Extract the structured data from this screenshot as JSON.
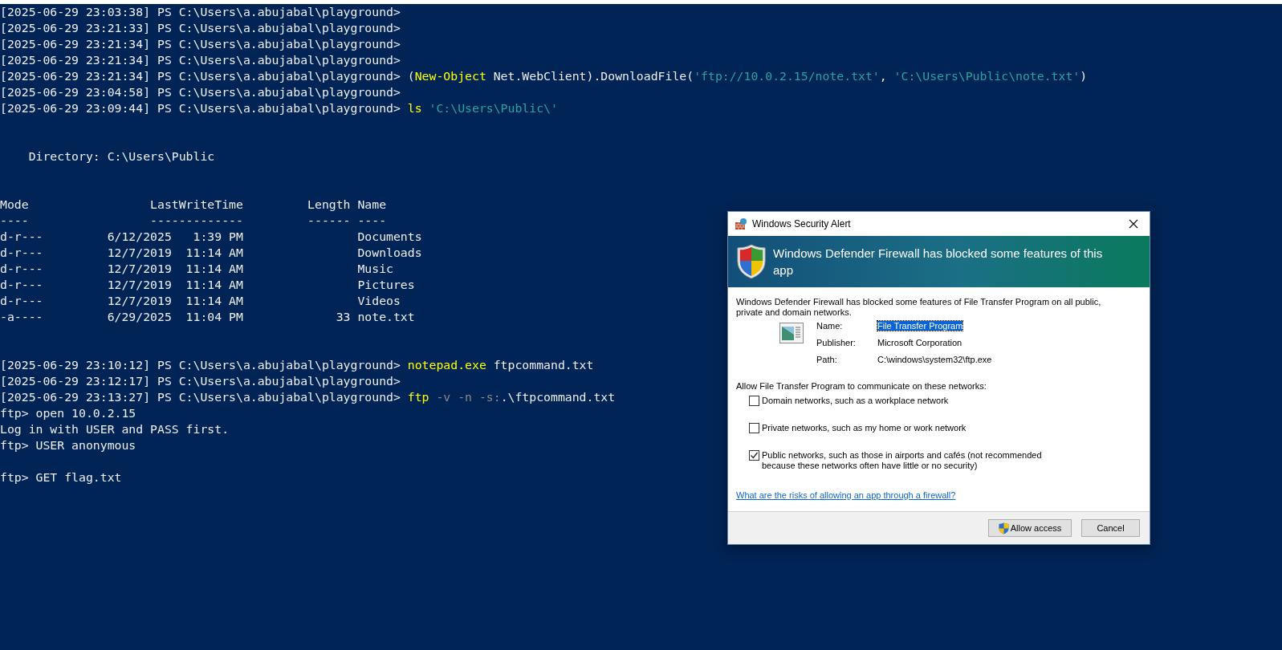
{
  "terminal": {
    "lines": [
      {
        "kind": "text",
        "segments": [
          {
            "kind": "plain",
            "text": "[2025-06-29 23:03:38] PS C:\\Users\\a.abujabal\\playground>"
          }
        ]
      },
      {
        "kind": "text",
        "segments": [
          {
            "kind": "plain",
            "text": "[2025-06-29 23:21:33] PS C:\\Users\\a.abujabal\\playground>"
          }
        ]
      },
      {
        "kind": "text",
        "segments": [
          {
            "kind": "plain",
            "text": "[2025-06-29 23:21:34] PS C:\\Users\\a.abujabal\\playground>"
          }
        ]
      },
      {
        "kind": "text",
        "segments": [
          {
            "kind": "plain",
            "text": "[2025-06-29 23:21:34] PS C:\\Users\\a.abujabal\\playground>"
          }
        ]
      },
      {
        "kind": "text",
        "segments": [
          {
            "kind": "plain",
            "text": "[2025-06-29 23:21:34] PS C:\\Users\\a.abujabal\\playground> ("
          },
          {
            "kind": "command",
            "text": "New-Object"
          },
          {
            "kind": "plain",
            "text": " Net.WebClient).DownloadFile("
          },
          {
            "kind": "string",
            "text": "'ftp://10.0.2.15/note.txt'"
          },
          {
            "kind": "plain",
            "text": ", "
          },
          {
            "kind": "string",
            "text": "'C:\\Users\\Public\\note.txt'"
          },
          {
            "kind": "plain",
            "text": ")"
          }
        ]
      },
      {
        "kind": "text",
        "segments": [
          {
            "kind": "plain",
            "text": "[2025-06-29 23:04:58] PS C:\\Users\\a.abujabal\\playground>"
          }
        ]
      },
      {
        "kind": "text",
        "segments": [
          {
            "kind": "plain",
            "text": "[2025-06-29 23:09:44] PS C:\\Users\\a.abujabal\\playground> "
          },
          {
            "kind": "command",
            "text": "ls"
          },
          {
            "kind": "string",
            "text": " 'C:\\Users\\Public\\'"
          }
        ]
      },
      {
        "kind": "blank"
      },
      {
        "kind": "blank"
      },
      {
        "kind": "text",
        "segments": [
          {
            "kind": "plain",
            "text": "    Directory: C:\\Users\\Public"
          }
        ]
      },
      {
        "kind": "blank"
      },
      {
        "kind": "blank"
      },
      {
        "kind": "text",
        "segments": [
          {
            "kind": "plain",
            "text": "Mode                 LastWriteTime         Length Name"
          }
        ]
      },
      {
        "kind": "text",
        "segments": [
          {
            "kind": "plain",
            "text": "----                 -------------         ------ ----"
          }
        ]
      },
      {
        "kind": "text",
        "segments": [
          {
            "kind": "plain",
            "text": "d-r---         6/12/2025   1:39 PM                Documents"
          }
        ]
      },
      {
        "kind": "text",
        "segments": [
          {
            "kind": "plain",
            "text": "d-r---         12/7/2019  11:14 AM                Downloads"
          }
        ]
      },
      {
        "kind": "text",
        "segments": [
          {
            "kind": "plain",
            "text": "d-r---         12/7/2019  11:14 AM                Music"
          }
        ]
      },
      {
        "kind": "text",
        "segments": [
          {
            "kind": "plain",
            "text": "d-r---         12/7/2019  11:14 AM                Pictures"
          }
        ]
      },
      {
        "kind": "text",
        "segments": [
          {
            "kind": "plain",
            "text": "d-r---         12/7/2019  11:14 AM                Videos"
          }
        ]
      },
      {
        "kind": "text",
        "segments": [
          {
            "kind": "plain",
            "text": "-a----         6/29/2025  11:04 PM             33 note.txt"
          }
        ]
      },
      {
        "kind": "blank"
      },
      {
        "kind": "blank"
      },
      {
        "kind": "text",
        "segments": [
          {
            "kind": "plain",
            "text": "[2025-06-29 23:10:12] PS C:\\Users\\a.abujabal\\playground> "
          },
          {
            "kind": "command",
            "text": "notepad.exe"
          },
          {
            "kind": "plain",
            "text": " ftpcommand.txt"
          }
        ]
      },
      {
        "kind": "text",
        "segments": [
          {
            "kind": "plain",
            "text": "[2025-06-29 23:12:17] PS C:\\Users\\a.abujabal\\playground>"
          }
        ]
      },
      {
        "kind": "text",
        "segments": [
          {
            "kind": "plain",
            "text": "[2025-06-29 23:13:27] PS C:\\Users\\a.abujabal\\playground> "
          },
          {
            "kind": "command",
            "text": "ftp"
          },
          {
            "kind": "param",
            "text": " -v -n -s:"
          },
          {
            "kind": "plain",
            "text": ".\\ftpcommand.txt"
          }
        ]
      },
      {
        "kind": "text",
        "segments": [
          {
            "kind": "plain",
            "text": "ftp> open 10.0.2.15"
          }
        ]
      },
      {
        "kind": "text",
        "segments": [
          {
            "kind": "plain",
            "text": "Log in with USER and PASS first."
          }
        ]
      },
      {
        "kind": "text",
        "segments": [
          {
            "kind": "plain",
            "text": "ftp> USER anonymous"
          }
        ]
      },
      {
        "kind": "blank"
      },
      {
        "kind": "text",
        "segments": [
          {
            "kind": "plain",
            "text": "ftp> GET flag.txt"
          }
        ]
      }
    ]
  },
  "alert": {
    "title": "Windows Security Alert",
    "heading": "Windows Defender Firewall has blocked some features of this app",
    "message": "Windows Defender Firewall has blocked some features of File Transfer Program on all public, private and domain networks.",
    "app_fields": [
      {
        "label": "Name:",
        "value": "File Transfer Program",
        "selected": true
      },
      {
        "label": "Publisher:",
        "value": "Microsoft Corporation",
        "selected": false
      },
      {
        "label": "Path:",
        "value": "C:\\windows\\system32\\ftp.exe",
        "selected": false
      }
    ],
    "networks_prompt": "Allow File Transfer Program to communicate on these networks:",
    "networks": [
      {
        "label": "Domain networks, such as a workplace network",
        "checked": false
      },
      {
        "label": "Private networks, such as my home or work network",
        "checked": false
      },
      {
        "label": "Public networks, such as those in airports and cafés (not recommended because these networks often have little or no security)",
        "checked": true
      }
    ],
    "link": "What are the risks of allowing an app through a firewall?",
    "buttons": [
      {
        "label": "Allow access",
        "kind": "elevated"
      },
      {
        "label": "Cancel",
        "kind": "plain"
      }
    ]
  }
}
